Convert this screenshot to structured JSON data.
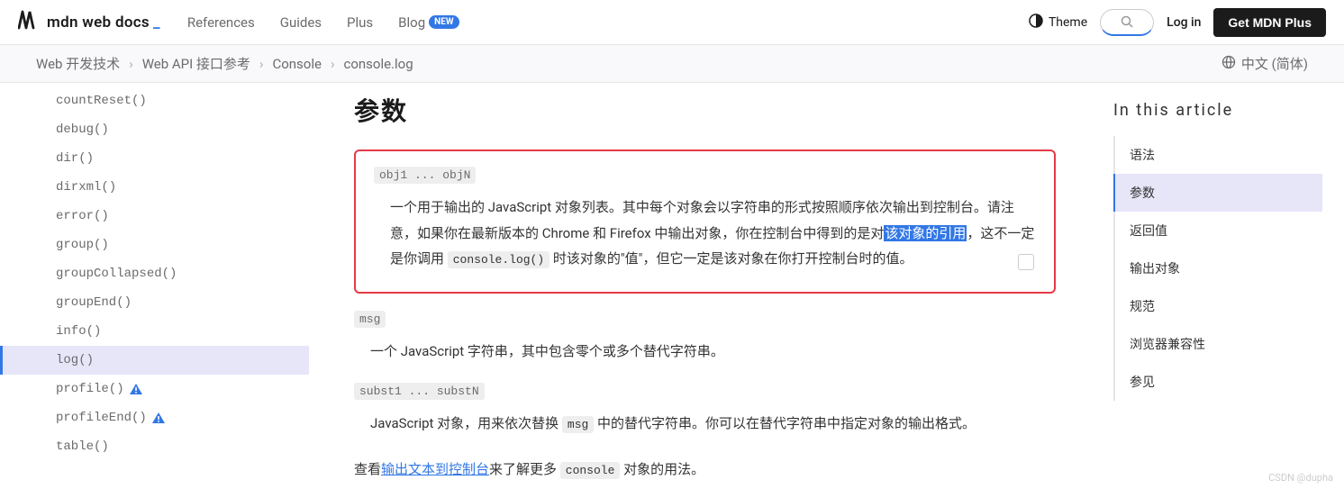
{
  "header": {
    "logo_text": "mdn web docs",
    "nav": [
      "References",
      "Guides",
      "Plus",
      "Blog"
    ],
    "new_badge": "NEW",
    "theme": "Theme",
    "login": "Log in",
    "plus_btn": "Get MDN Plus"
  },
  "breadcrumb": {
    "items": [
      "Web 开发技术",
      "Web API 接口参考",
      "Console",
      "console.log"
    ],
    "lang": "中文 (简体)"
  },
  "sidebar": {
    "items": [
      {
        "label": "countReset()",
        "active": false,
        "warn": false
      },
      {
        "label": "debug()",
        "active": false,
        "warn": false
      },
      {
        "label": "dir()",
        "active": false,
        "warn": false
      },
      {
        "label": "dirxml()",
        "active": false,
        "warn": false
      },
      {
        "label": "error()",
        "active": false,
        "warn": false
      },
      {
        "label": "group()",
        "active": false,
        "warn": false
      },
      {
        "label": "groupCollapsed()",
        "active": false,
        "warn": false
      },
      {
        "label": "groupEnd()",
        "active": false,
        "warn": false
      },
      {
        "label": "info()",
        "active": false,
        "warn": false
      },
      {
        "label": "log()",
        "active": true,
        "warn": false
      },
      {
        "label": "profile()",
        "active": false,
        "warn": true
      },
      {
        "label": "profileEnd()",
        "active": false,
        "warn": true
      },
      {
        "label": "table()",
        "active": false,
        "warn": false
      }
    ]
  },
  "content": {
    "heading": "参数",
    "param1_code": "obj1 ... objN",
    "param1_desc_a": "一个用于输出的 JavaScript 对象列表。其中每个对象会以字符串的形式按照顺序依次输出到控制台。请注意，如果你在最新版本的 Chrome 和 Firefox 中输出对象，你在控制台中得到的是对",
    "param1_desc_hl": "该对象的引用",
    "param1_desc_b": "，这不一定是你调用 ",
    "param1_inline1": "console.log()",
    "param1_desc_c": " 时该对象的\"值\"，但它一定是该对象在你打开控制台时的值。",
    "param2_code": "msg",
    "param2_desc": "一个 JavaScript 字符串，其中包含零个或多个替代字符串。",
    "param3_code": "subst1 ... substN",
    "param3_desc_a": "JavaScript 对象，用来依次替换 ",
    "param3_inline": "msg",
    "param3_desc_b": " 中的替代字符串。你可以在替代字符串中指定对象的输出格式。",
    "footer_a": "查看",
    "footer_link": "输出文本到控制台",
    "footer_b": "来了解更多 ",
    "footer_code": "console",
    "footer_c": " 对象的用法。"
  },
  "toc": {
    "title": "In this article",
    "items": [
      {
        "label": "语法",
        "active": false
      },
      {
        "label": "参数",
        "active": true
      },
      {
        "label": "返回值",
        "active": false
      },
      {
        "label": "输出对象",
        "active": false
      },
      {
        "label": "规范",
        "active": false
      },
      {
        "label": "浏览器兼容性",
        "active": false
      },
      {
        "label": "参见",
        "active": false
      }
    ]
  },
  "watermark": "CSDN @dupha"
}
